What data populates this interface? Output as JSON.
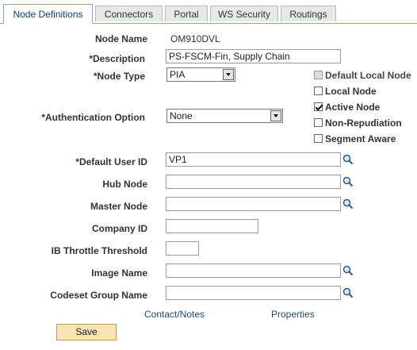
{
  "tabs": [
    {
      "label": "Node Definitions",
      "active": true
    },
    {
      "label": "Connectors",
      "active": false
    },
    {
      "label": "Portal",
      "active": false
    },
    {
      "label": "WS Security",
      "active": false
    },
    {
      "label": "Routings",
      "active": false
    }
  ],
  "form": {
    "node_name_label": "Node Name",
    "node_name_value": "OM910DVL",
    "description_label": "*Description",
    "description_value": "PS-FSCM-Fin, Supply Chain",
    "node_type_label": "*Node Type",
    "node_type_value": "PIA",
    "auth_option_label": "*Authentication Option",
    "auth_option_value": "None",
    "default_user_label": "*Default User ID",
    "default_user_value": "VP1",
    "hub_node_label": "Hub Node",
    "hub_node_value": "",
    "master_node_label": "Master Node",
    "master_node_value": "",
    "company_id_label": "Company ID",
    "company_id_value": "",
    "ib_throttle_label": "IB Throttle Threshold",
    "ib_throttle_value": "",
    "image_name_label": "Image Name",
    "image_name_value": "",
    "codeset_label": "Codeset Group Name",
    "codeset_value": ""
  },
  "checkboxes": [
    {
      "label": "Default Local Node",
      "checked": false,
      "disabled": true
    },
    {
      "label": "Local Node",
      "checked": false,
      "disabled": false
    },
    {
      "label": "Active Node",
      "checked": true,
      "disabled": false
    },
    {
      "label": "Non-Repudiation",
      "checked": false,
      "disabled": false
    },
    {
      "label": "Segment Aware",
      "checked": false,
      "disabled": false
    }
  ],
  "links": {
    "contact_notes": "Contact/Notes",
    "properties": "Properties"
  },
  "buttons": {
    "save": "Save"
  },
  "icons": {
    "lookup": "magnifier-lookup-icon",
    "dropdown": "chevron-down-icon"
  }
}
